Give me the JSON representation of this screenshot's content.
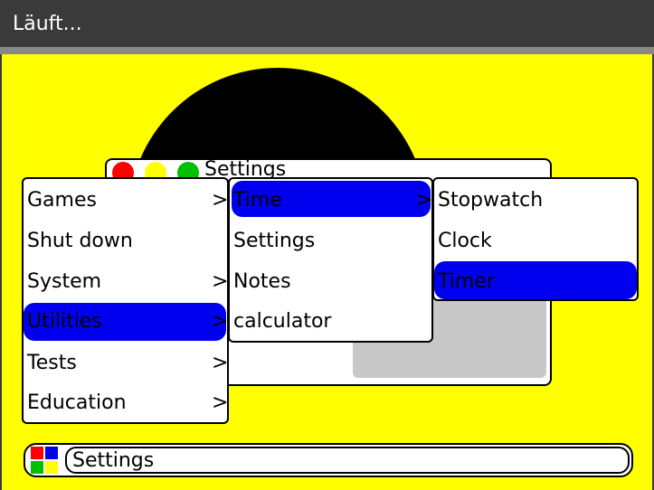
{
  "status_title": "Läuft...",
  "colors": {
    "screen_bg": "#ffff00",
    "highlight": "#0000ee",
    "red": "#ff0000",
    "yellow": "#ffff00",
    "green": "#00c000",
    "blue": "#0000ee"
  },
  "window": {
    "title": "Settings"
  },
  "menu_main": {
    "items": [
      {
        "label": "Games",
        "arrow": ">"
      },
      {
        "label": "Shut down",
        "arrow": ""
      },
      {
        "label": "System",
        "arrow": ">"
      },
      {
        "label": "Utilities",
        "arrow": ">",
        "selected": true
      },
      {
        "label": "Tests",
        "arrow": ">"
      },
      {
        "label": "Education",
        "arrow": ">"
      }
    ]
  },
  "menu_utilities": {
    "items": [
      {
        "label": "Time",
        "arrow": ">",
        "selected": true
      },
      {
        "label": "Settings",
        "arrow": ""
      },
      {
        "label": "Notes",
        "arrow": ""
      },
      {
        "label": "calculator",
        "arrow": ""
      }
    ]
  },
  "menu_time": {
    "items": [
      {
        "label": "Stopwatch"
      },
      {
        "label": "Clock"
      },
      {
        "label": "Timer",
        "selected": true
      }
    ]
  },
  "taskbar": {
    "label": "Settings"
  }
}
